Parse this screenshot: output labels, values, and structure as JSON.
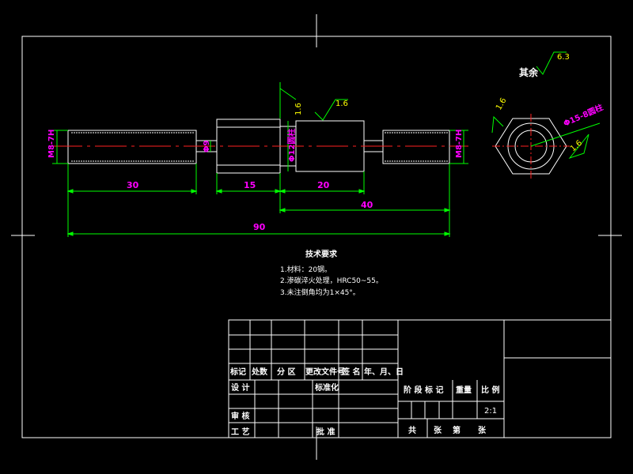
{
  "colors": {
    "background": "#000000",
    "frame": "#ffffff",
    "dimension": "#00ff00",
    "part_text": "#ff00ff",
    "centerline": "#ff2020",
    "roughness": "#00ff00",
    "text": "#ffffff",
    "angle_text": "#ffff00"
  },
  "dimensions": {
    "d30": "30",
    "d15": "15",
    "d20": "20",
    "d40": "40",
    "d90": "90",
    "phi9": "Φ9",
    "phi12": "Φ12圆柱",
    "m8_left": "M8-7H",
    "m8_right": "M8-7H",
    "phi15": "Φ15-8圆柱"
  },
  "roughness": {
    "other_label": "其余",
    "other_value": "6.3",
    "top_value": "1.6",
    "shoulder_value": "1.6",
    "right_a": "1.6",
    "right_b": "1.6"
  },
  "tech": {
    "title": "技术要求",
    "lines": [
      "1.材料：20钢。",
      "2.渗碳淬火处理，HRC50~55。",
      "3.未注倒角均为1×45°。"
    ]
  },
  "title_block": {
    "mark": "标记",
    "count": "处数",
    "zone": "分 区",
    "change_doc": "更改文件号",
    "sign": "签 名",
    "date": "年、月、日",
    "design": "设 计",
    "standardize": "标准化",
    "stage_mark": "阶 段 标 记",
    "weight": "重量",
    "scale": "比 例",
    "scale_value": "2:1",
    "review": "审 核",
    "process": "工 艺",
    "approve": "批 准",
    "total": "共",
    "sheet_unit": "张",
    "page": "第",
    "page_unit": "张"
  }
}
